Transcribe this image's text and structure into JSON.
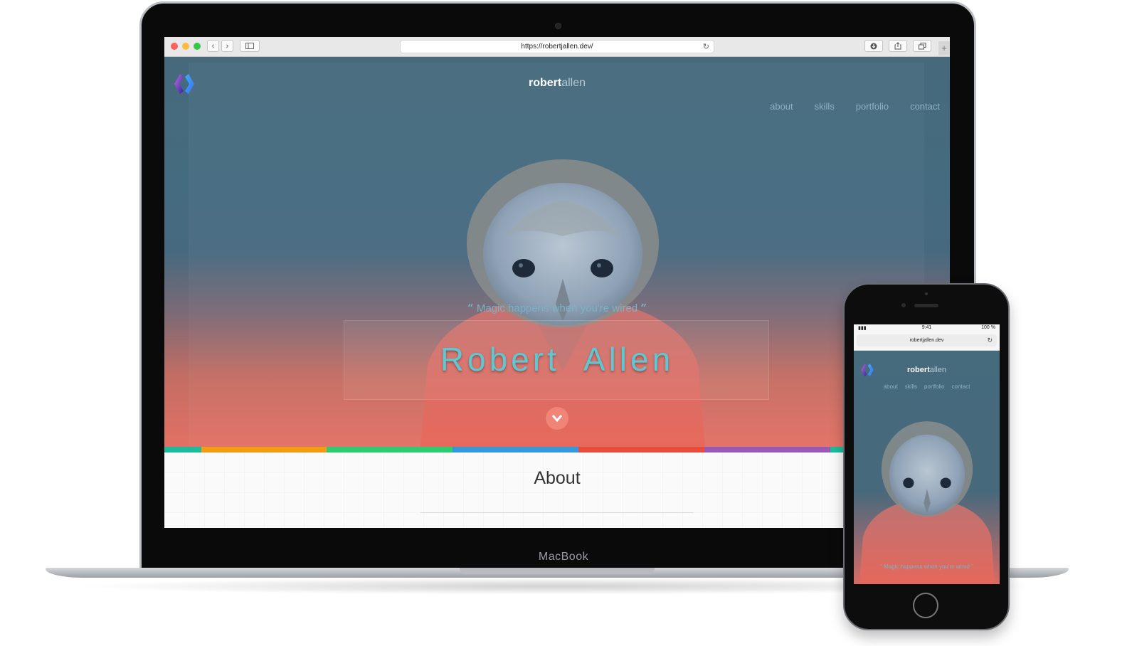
{
  "laptop": {
    "brand": "MacBook",
    "browser": {
      "url": "https://robertjallen.dev/",
      "reload_icon": "reload-icon",
      "back_icon": "chevron-left-icon",
      "forward_icon": "chevron-right-icon",
      "sidebar_icon": "sidebar-icon",
      "download_icon": "download-icon",
      "share_icon": "share-icon",
      "tabs_icon": "tabs-icon",
      "new_tab_symbol": "+"
    },
    "site": {
      "brand_bold": "robert",
      "brand_light": "allen",
      "nav": [
        "about",
        "skills",
        "portfolio",
        "contact"
      ],
      "quote_open": "“",
      "quote": "Magic happens when you're wired",
      "quote_close": "”",
      "name": "Robert  Allen",
      "scroll_icon": "chevron-down-circle-icon",
      "section_title": "About",
      "stripe_colors": [
        "#1abc9c",
        "#f39c12",
        "#2ecc71",
        "#3498db",
        "#e74c3c",
        "#9b59b6",
        "#1abc9c"
      ]
    }
  },
  "phone": {
    "status": {
      "time": "9:41",
      "battery": "100 %",
      "signal": "signal-icon"
    },
    "url": "robertjallen.dev",
    "site": {
      "brand_bold": "robert",
      "brand_light": "allen",
      "nav": [
        "about",
        "skills",
        "portfolio",
        "contact"
      ],
      "quote": "Magic happens when you're wired"
    }
  },
  "colors": {
    "accent": "#5ec7d2",
    "nav_text": "#8fb1c4",
    "hero_top": "#466a7c",
    "hero_bottom": "#e27064"
  }
}
